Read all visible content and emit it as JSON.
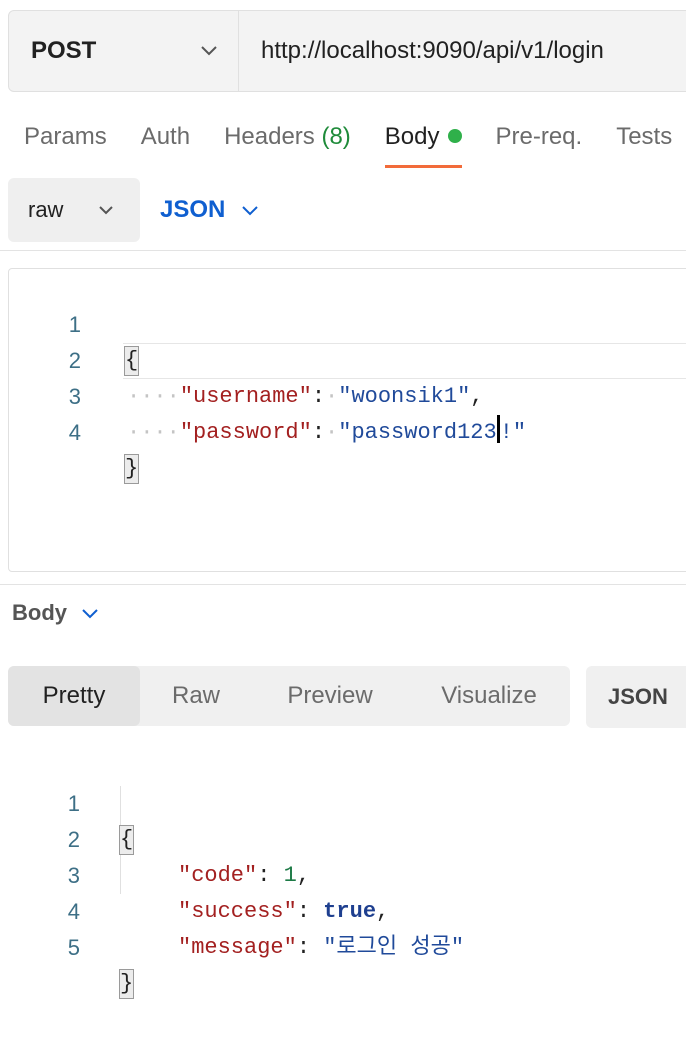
{
  "request": {
    "method": "POST",
    "url": "http://localhost:9090/api/v1/login"
  },
  "tabs": [
    {
      "label": "Params"
    },
    {
      "label": "Auth"
    },
    {
      "label": "Headers",
      "count": "(8)"
    },
    {
      "label": "Body",
      "active": true
    },
    {
      "label": "Pre-req."
    },
    {
      "label": "Tests"
    }
  ],
  "body_mode": {
    "type": "raw",
    "format": "JSON"
  },
  "request_body": {
    "line_numbers": [
      "1",
      "2",
      "3",
      "4"
    ],
    "open_brace": "{",
    "close_brace": "}",
    "indent": "····",
    "key1": "\"username\"",
    "val1": "\"woonsik1\"",
    "key2": "\"password\"",
    "val2_before_caret": "\"password123",
    "val2_after_caret": "!\""
  },
  "response": {
    "section_label": "Body",
    "view_tabs": [
      "Pretty",
      "Raw",
      "Preview",
      "Visualize"
    ],
    "active_view": "Pretty",
    "format": "JSON",
    "line_numbers": [
      "1",
      "2",
      "3",
      "4",
      "5"
    ],
    "open_brace": "{",
    "close_brace": "}",
    "key1": "\"code\"",
    "val1": "1",
    "key2": "\"success\"",
    "val2": "true",
    "key3": "\"message\"",
    "val3": "\"로그인 성공\""
  },
  "colors": {
    "accent": "#f26b3a",
    "link_blue": "#0f5fd0",
    "status_green": "#2fb04a"
  }
}
